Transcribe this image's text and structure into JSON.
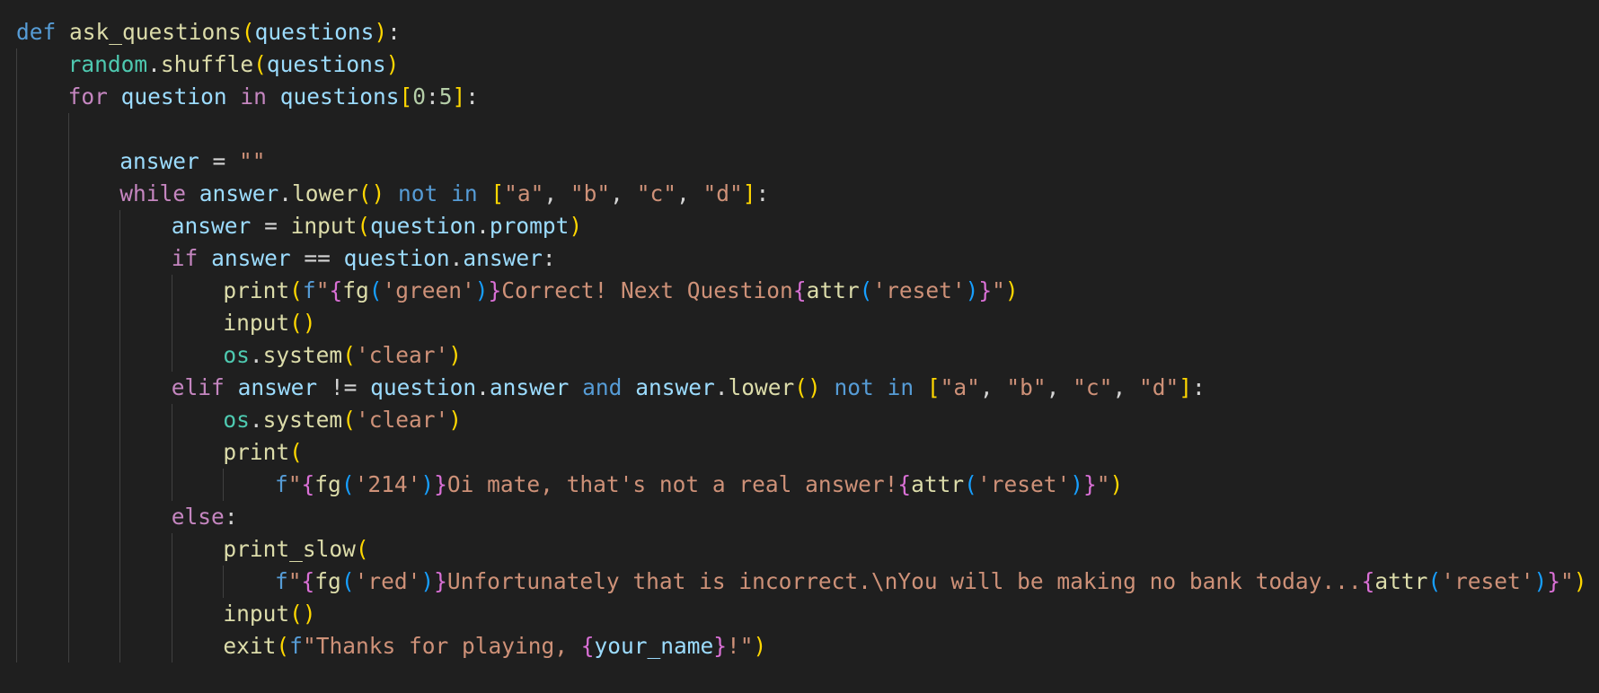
{
  "editor": {
    "colors": {
      "background": "#1f1f1f",
      "keyword": "#569cd6",
      "control": "#c586c0",
      "function": "#dcdcaa",
      "module": "#4ec9b0",
      "variable": "#9cdcfe",
      "string": "#ce9178",
      "number": "#b5cea8",
      "bracket_1": "#ffd700",
      "bracket_2": "#da70d6",
      "bracket_3": "#179fff",
      "indent_guide": "#404040"
    },
    "lines": [
      {
        "indent": 0,
        "tokens": [
          [
            "keyword",
            "def"
          ],
          [
            "punct",
            " "
          ],
          [
            "function",
            "ask_questions"
          ],
          [
            "brace-1",
            "("
          ],
          [
            "variable",
            "questions"
          ],
          [
            "brace-1",
            ")"
          ],
          [
            "punct",
            ":"
          ]
        ]
      },
      {
        "indent": 1,
        "tokens": [
          [
            "module",
            "random"
          ],
          [
            "punct",
            "."
          ],
          [
            "function",
            "shuffle"
          ],
          [
            "brace-1",
            "("
          ],
          [
            "variable",
            "questions"
          ],
          [
            "brace-1",
            ")"
          ]
        ]
      },
      {
        "indent": 1,
        "tokens": [
          [
            "control",
            "for"
          ],
          [
            "punct",
            " "
          ],
          [
            "variable",
            "question"
          ],
          [
            "punct",
            " "
          ],
          [
            "control",
            "in"
          ],
          [
            "punct",
            " "
          ],
          [
            "variable",
            "questions"
          ],
          [
            "brace-1",
            "["
          ],
          [
            "number",
            "0"
          ],
          [
            "punct",
            ":"
          ],
          [
            "number",
            "5"
          ],
          [
            "brace-1",
            "]"
          ],
          [
            "punct",
            ":"
          ]
        ]
      },
      {
        "indent": 2,
        "tokens": []
      },
      {
        "indent": 2,
        "tokens": [
          [
            "variable",
            "answer"
          ],
          [
            "operator",
            " = "
          ],
          [
            "string",
            "\"\""
          ]
        ]
      },
      {
        "indent": 2,
        "tokens": [
          [
            "control",
            "while"
          ],
          [
            "punct",
            " "
          ],
          [
            "variable",
            "answer"
          ],
          [
            "punct",
            "."
          ],
          [
            "function",
            "lower"
          ],
          [
            "brace-1",
            "()"
          ],
          [
            "punct",
            " "
          ],
          [
            "keyword",
            "not"
          ],
          [
            "punct",
            " "
          ],
          [
            "keyword",
            "in"
          ],
          [
            "punct",
            " "
          ],
          [
            "brace-1",
            "["
          ],
          [
            "string",
            "\"a\""
          ],
          [
            "punct",
            ", "
          ],
          [
            "string",
            "\"b\""
          ],
          [
            "punct",
            ", "
          ],
          [
            "string",
            "\"c\""
          ],
          [
            "punct",
            ", "
          ],
          [
            "string",
            "\"d\""
          ],
          [
            "brace-1",
            "]"
          ],
          [
            "punct",
            ":"
          ]
        ]
      },
      {
        "indent": 3,
        "tokens": [
          [
            "variable",
            "answer"
          ],
          [
            "operator",
            " = "
          ],
          [
            "function",
            "input"
          ],
          [
            "brace-1",
            "("
          ],
          [
            "variable",
            "question"
          ],
          [
            "punct",
            "."
          ],
          [
            "variable",
            "prompt"
          ],
          [
            "brace-1",
            ")"
          ]
        ]
      },
      {
        "indent": 3,
        "tokens": [
          [
            "control",
            "if"
          ],
          [
            "punct",
            " "
          ],
          [
            "variable",
            "answer"
          ],
          [
            "operator",
            " == "
          ],
          [
            "variable",
            "question"
          ],
          [
            "punct",
            "."
          ],
          [
            "variable",
            "answer"
          ],
          [
            "punct",
            ":"
          ]
        ]
      },
      {
        "indent": 4,
        "tokens": [
          [
            "function",
            "print"
          ],
          [
            "brace-1",
            "("
          ],
          [
            "keyword",
            "f"
          ],
          [
            "string",
            "\""
          ],
          [
            "brace-2",
            "{"
          ],
          [
            "function",
            "fg"
          ],
          [
            "brace-3",
            "("
          ],
          [
            "string",
            "'green'"
          ],
          [
            "brace-3",
            ")"
          ],
          [
            "brace-2",
            "}"
          ],
          [
            "string",
            "Correct! Next Question"
          ],
          [
            "brace-2",
            "{"
          ],
          [
            "function",
            "attr"
          ],
          [
            "brace-3",
            "("
          ],
          [
            "string",
            "'reset'"
          ],
          [
            "brace-3",
            ")"
          ],
          [
            "brace-2",
            "}"
          ],
          [
            "string",
            "\""
          ],
          [
            "brace-1",
            ")"
          ]
        ]
      },
      {
        "indent": 4,
        "tokens": [
          [
            "function",
            "input"
          ],
          [
            "brace-1",
            "()"
          ]
        ]
      },
      {
        "indent": 4,
        "tokens": [
          [
            "module",
            "os"
          ],
          [
            "punct",
            "."
          ],
          [
            "function",
            "system"
          ],
          [
            "brace-1",
            "("
          ],
          [
            "string",
            "'clear'"
          ],
          [
            "brace-1",
            ")"
          ]
        ]
      },
      {
        "indent": 3,
        "tokens": [
          [
            "control",
            "elif"
          ],
          [
            "punct",
            " "
          ],
          [
            "variable",
            "answer"
          ],
          [
            "operator",
            " != "
          ],
          [
            "variable",
            "question"
          ],
          [
            "punct",
            "."
          ],
          [
            "variable",
            "answer"
          ],
          [
            "punct",
            " "
          ],
          [
            "keyword",
            "and"
          ],
          [
            "punct",
            " "
          ],
          [
            "variable",
            "answer"
          ],
          [
            "punct",
            "."
          ],
          [
            "function",
            "lower"
          ],
          [
            "brace-1",
            "()"
          ],
          [
            "punct",
            " "
          ],
          [
            "keyword",
            "not"
          ],
          [
            "punct",
            " "
          ],
          [
            "keyword",
            "in"
          ],
          [
            "punct",
            " "
          ],
          [
            "brace-1",
            "["
          ],
          [
            "string",
            "\"a\""
          ],
          [
            "punct",
            ", "
          ],
          [
            "string",
            "\"b\""
          ],
          [
            "punct",
            ", "
          ],
          [
            "string",
            "\"c\""
          ],
          [
            "punct",
            ", "
          ],
          [
            "string",
            "\"d\""
          ],
          [
            "brace-1",
            "]"
          ],
          [
            "punct",
            ":"
          ]
        ]
      },
      {
        "indent": 4,
        "tokens": [
          [
            "module",
            "os"
          ],
          [
            "punct",
            "."
          ],
          [
            "function",
            "system"
          ],
          [
            "brace-1",
            "("
          ],
          [
            "string",
            "'clear'"
          ],
          [
            "brace-1",
            ")"
          ]
        ]
      },
      {
        "indent": 4,
        "tokens": [
          [
            "function",
            "print"
          ],
          [
            "brace-1",
            "("
          ]
        ]
      },
      {
        "indent": 5,
        "tokens": [
          [
            "keyword",
            "f"
          ],
          [
            "string",
            "\""
          ],
          [
            "brace-2",
            "{"
          ],
          [
            "function",
            "fg"
          ],
          [
            "brace-3",
            "("
          ],
          [
            "string",
            "'214'"
          ],
          [
            "brace-3",
            ")"
          ],
          [
            "brace-2",
            "}"
          ],
          [
            "string",
            "Oi mate, that's not a real answer!"
          ],
          [
            "brace-2",
            "{"
          ],
          [
            "function",
            "attr"
          ],
          [
            "brace-3",
            "("
          ],
          [
            "string",
            "'reset'"
          ],
          [
            "brace-3",
            ")"
          ],
          [
            "brace-2",
            "}"
          ],
          [
            "string",
            "\""
          ],
          [
            "brace-1",
            ")"
          ]
        ]
      },
      {
        "indent": 3,
        "tokens": [
          [
            "control",
            "else"
          ],
          [
            "punct",
            ":"
          ]
        ]
      },
      {
        "indent": 4,
        "tokens": [
          [
            "function",
            "print_slow"
          ],
          [
            "brace-1",
            "("
          ]
        ]
      },
      {
        "indent": 5,
        "tokens": [
          [
            "keyword",
            "f"
          ],
          [
            "string",
            "\""
          ],
          [
            "brace-2",
            "{"
          ],
          [
            "function",
            "fg"
          ],
          [
            "brace-3",
            "("
          ],
          [
            "string",
            "'red'"
          ],
          [
            "brace-3",
            ")"
          ],
          [
            "brace-2",
            "}"
          ],
          [
            "string",
            "Unfortunately that is incorrect.\\nYou will be making no bank today..."
          ],
          [
            "brace-2",
            "{"
          ],
          [
            "function",
            "attr"
          ],
          [
            "brace-3",
            "("
          ],
          [
            "string",
            "'reset'"
          ],
          [
            "brace-3",
            ")"
          ],
          [
            "brace-2",
            "}"
          ],
          [
            "string",
            "\""
          ],
          [
            "brace-1",
            ")"
          ]
        ]
      },
      {
        "indent": 4,
        "tokens": [
          [
            "function",
            "input"
          ],
          [
            "brace-1",
            "()"
          ]
        ]
      },
      {
        "indent": 4,
        "tokens": [
          [
            "function",
            "exit"
          ],
          [
            "brace-1",
            "("
          ],
          [
            "keyword",
            "f"
          ],
          [
            "string",
            "\"Thanks for playing, "
          ],
          [
            "brace-2",
            "{"
          ],
          [
            "variable",
            "your_name"
          ],
          [
            "brace-2",
            "}"
          ],
          [
            "string",
            "!\""
          ],
          [
            "brace-1",
            ")"
          ]
        ]
      }
    ]
  }
}
